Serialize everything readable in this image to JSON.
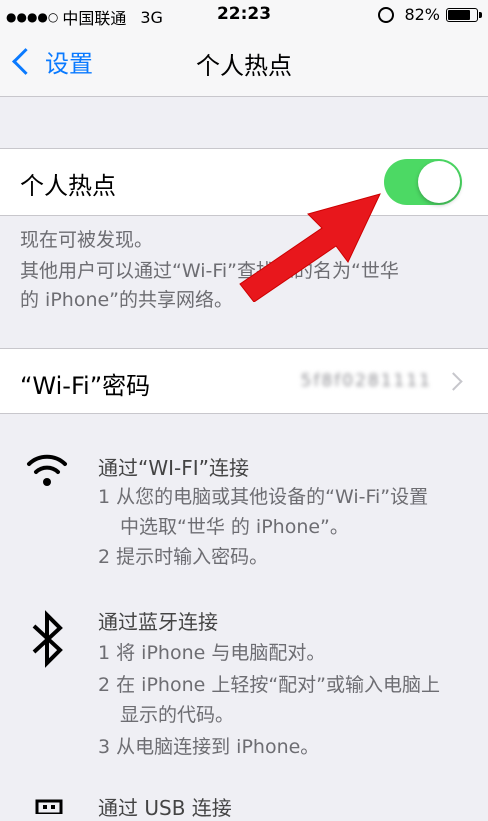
{
  "status_bar": {
    "signal_dots": "●●●●○",
    "carrier": "中国联通",
    "network": "3G",
    "time": "22:23",
    "battery_percent": "82%",
    "battery_level": 0.82
  },
  "nav": {
    "back_label": "设置",
    "title": "个人热点"
  },
  "hotspot": {
    "label": "个人热点",
    "enabled": true,
    "toggle_color": "#4cd964"
  },
  "discoverable": {
    "line1": "现在可被发现。",
    "line2": "其他用户可以通过“Wi-Fi”查找您的名为“世华",
    "line3": "的 iPhone”的共享网络。"
  },
  "wifi_password": {
    "label": "“Wi-Fi”密码",
    "value": "5f8f0281111"
  },
  "wifi_section": {
    "icon": "wifi-icon",
    "title": "通过“WI-FI”连接",
    "step1_a": "1 从您的电脑或其他设备的“Wi-Fi”设置",
    "step1_b": "中选取“世华 的 iPhone”。",
    "step2": "2 提示时输入密码。"
  },
  "bluetooth_section": {
    "icon": "bluetooth-icon",
    "title": "通过蓝牙连接",
    "step1": "1 将 iPhone 与电脑配对。",
    "step2_a": "2 在 iPhone 上轻按“配对”或输入电脑上",
    "step2_b": "显示的代码。",
    "step3": "3 从电脑连接到 iPhone。"
  },
  "usb_section": {
    "icon": "usb-icon",
    "title": "通过 USB 连接"
  },
  "colors": {
    "accent": "#0a7aff",
    "arrow": "#e8171c"
  }
}
